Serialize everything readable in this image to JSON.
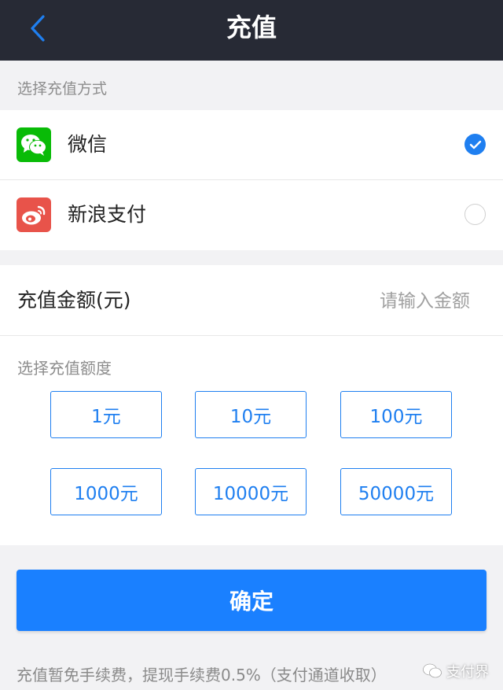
{
  "header": {
    "title": "充值",
    "back_icon": "chevron-left-icon"
  },
  "payment": {
    "section_label": "选择充值方式",
    "methods": [
      {
        "name": "微信",
        "icon": "wechat-icon",
        "color": "#09bb07",
        "selected": true
      },
      {
        "name": "新浪支付",
        "icon": "weibo-icon",
        "color": "#e8534a",
        "selected": false
      }
    ]
  },
  "amount": {
    "label": "充值金额(元)",
    "placeholder": "请输入金额",
    "value": ""
  },
  "quota": {
    "section_label": "选择充值额度",
    "options": [
      "1元",
      "10元",
      "100元",
      "1000元",
      "10000元",
      "50000元"
    ]
  },
  "confirm_label": "确定",
  "note": "充值暂免手续费，提现手续费0.5%（支付通道收取）",
  "watermark": "支付界",
  "colors": {
    "accent": "#1a80ff",
    "header_bg": "#272a35",
    "page_bg": "#f2f2f4"
  }
}
